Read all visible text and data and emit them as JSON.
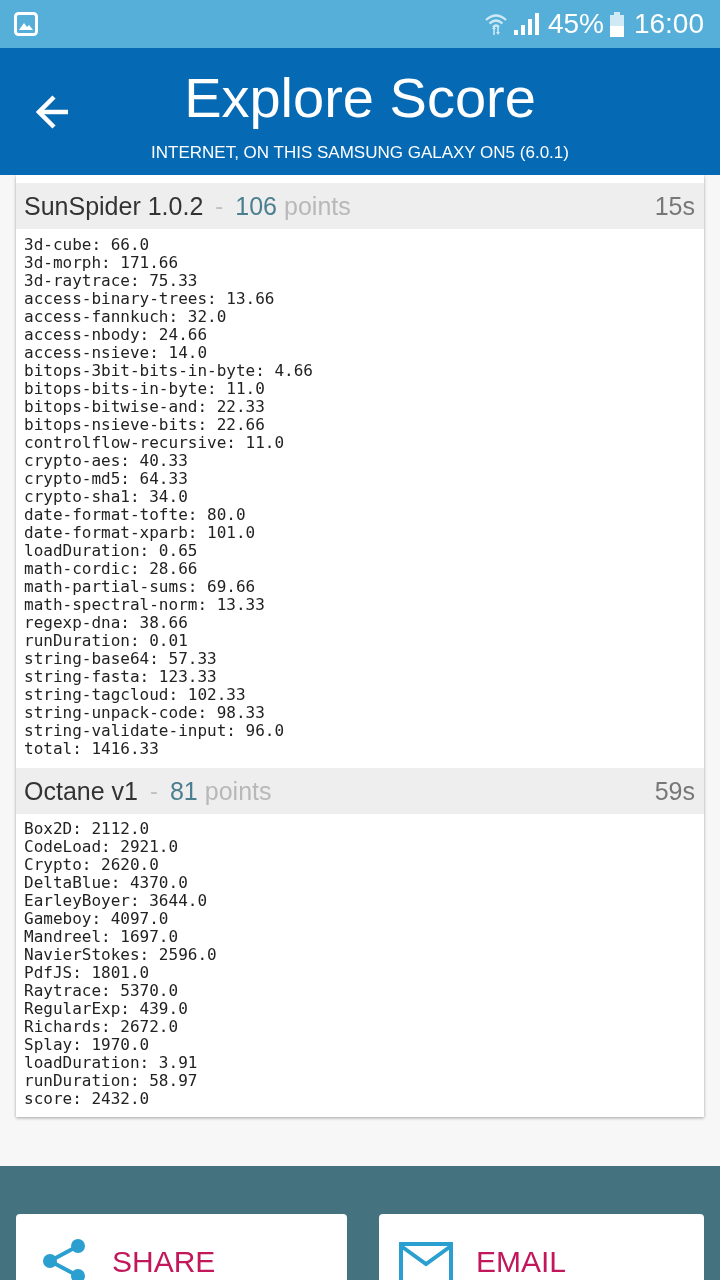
{
  "status_bar": {
    "battery": "45%",
    "time": "16:00"
  },
  "app_bar": {
    "title": "Explore Score",
    "subtitle": "INTERNET, ON THIS SAMSUNG GALAXY ON5 (6.0.1)"
  },
  "benchmarks": [
    {
      "name": "SunSpider 1.0.2",
      "separator": "-",
      "score": "106",
      "unit": "points",
      "duration": "15s",
      "results": [
        "3d-cube: 66.0",
        "3d-morph: 171.66",
        "3d-raytrace: 75.33",
        "access-binary-trees: 13.66",
        "access-fannkuch: 32.0",
        "access-nbody: 24.66",
        "access-nsieve: 14.0",
        "bitops-3bit-bits-in-byte: 4.66",
        "bitops-bits-in-byte: 11.0",
        "bitops-bitwise-and: 22.33",
        "bitops-nsieve-bits: 22.66",
        "controlflow-recursive: 11.0",
        "crypto-aes: 40.33",
        "crypto-md5: 64.33",
        "crypto-sha1: 34.0",
        "date-format-tofte: 80.0",
        "date-format-xparb: 101.0",
        "loadDuration: 0.65",
        "math-cordic: 28.66",
        "math-partial-sums: 69.66",
        "math-spectral-norm: 13.33",
        "regexp-dna: 38.66",
        "runDuration: 0.01",
        "string-base64: 57.33",
        "string-fasta: 123.33",
        "string-tagcloud: 102.33",
        "string-unpack-code: 98.33",
        "string-validate-input: 96.0",
        "total: 1416.33"
      ]
    },
    {
      "name": "Octane v1",
      "separator": "-",
      "score": "81",
      "unit": "points",
      "duration": "59s",
      "results": [
        "Box2D: 2112.0",
        "CodeLoad: 2921.0",
        "Crypto: 2620.0",
        "DeltaBlue: 4370.0",
        "EarleyBoyer: 3644.0",
        "Gameboy: 4097.0",
        "Mandreel: 1697.0",
        "NavierStokes: 2596.0",
        "PdfJS: 1801.0",
        "Raytrace: 5370.0",
        "RegularExp: 439.0",
        "Richards: 2672.0",
        "Splay: 1970.0",
        "loadDuration: 3.91",
        "runDuration: 58.97",
        "score: 2432.0"
      ]
    }
  ],
  "actions": [
    {
      "kind": "share",
      "label": "SHARE"
    },
    {
      "kind": "email",
      "label": "EMAIL"
    }
  ]
}
